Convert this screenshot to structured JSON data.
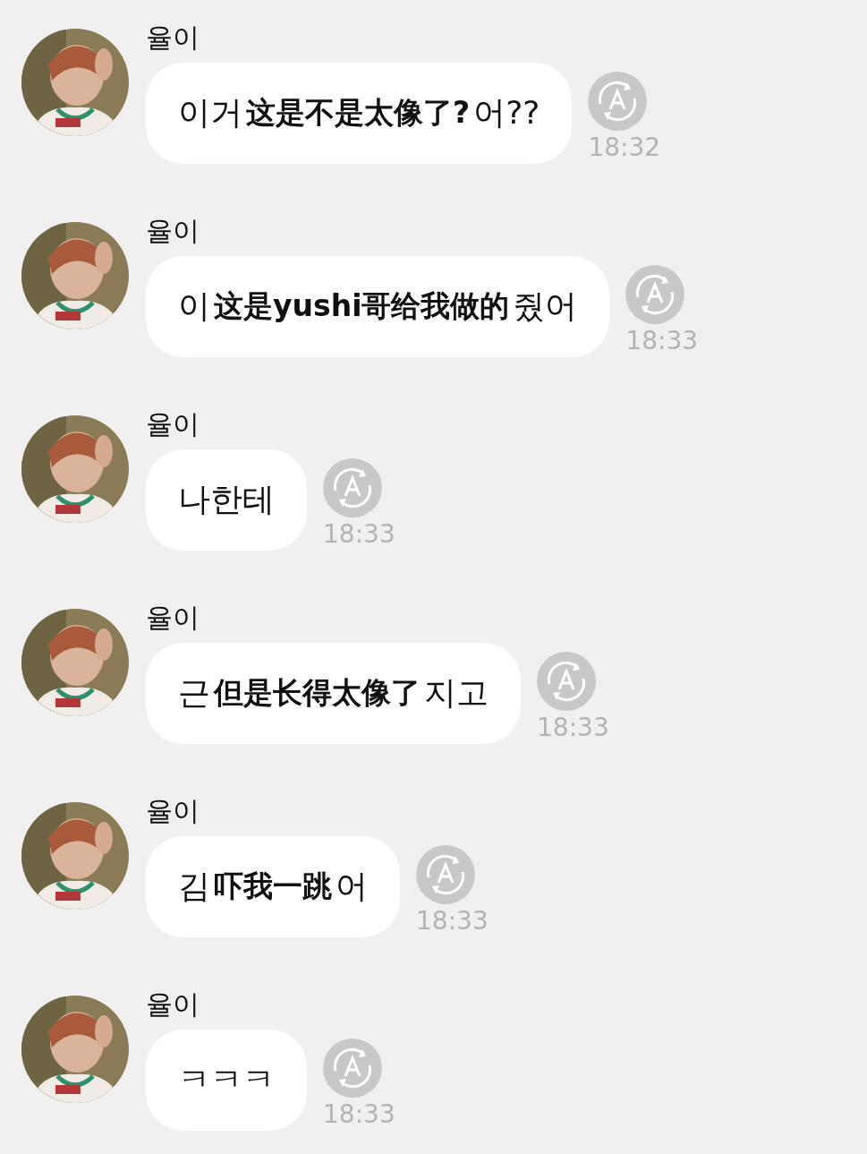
{
  "messages": [
    {
      "sender": "율이",
      "segments": [
        {
          "kind": "original",
          "text": "이거"
        },
        {
          "kind": "translation",
          "text": "这是不是太像了?"
        },
        {
          "kind": "original",
          "text": "어??"
        }
      ],
      "time": "18:32"
    },
    {
      "sender": "율이",
      "segments": [
        {
          "kind": "original",
          "text": "이"
        },
        {
          "kind": "translation",
          "text": "这是yushi哥给我做的"
        },
        {
          "kind": "original",
          "text": "줬어"
        }
      ],
      "time": "18:33"
    },
    {
      "sender": "율이",
      "segments": [
        {
          "kind": "original",
          "text": "나한테"
        }
      ],
      "time": "18:33"
    },
    {
      "sender": "율이",
      "segments": [
        {
          "kind": "original",
          "text": "근"
        },
        {
          "kind": "translation",
          "text": "但是长得太像了"
        },
        {
          "kind": "original",
          "text": "지고"
        }
      ],
      "time": "18:33"
    },
    {
      "sender": "율이",
      "segments": [
        {
          "kind": "original",
          "text": "김"
        },
        {
          "kind": "translation",
          "text": "吓我一跳"
        },
        {
          "kind": "original",
          "text": "어"
        }
      ],
      "time": "18:33"
    },
    {
      "sender": "율이",
      "segments": [
        {
          "kind": "original",
          "text": "ㅋㅋㅋ"
        }
      ],
      "time": "18:33"
    }
  ]
}
